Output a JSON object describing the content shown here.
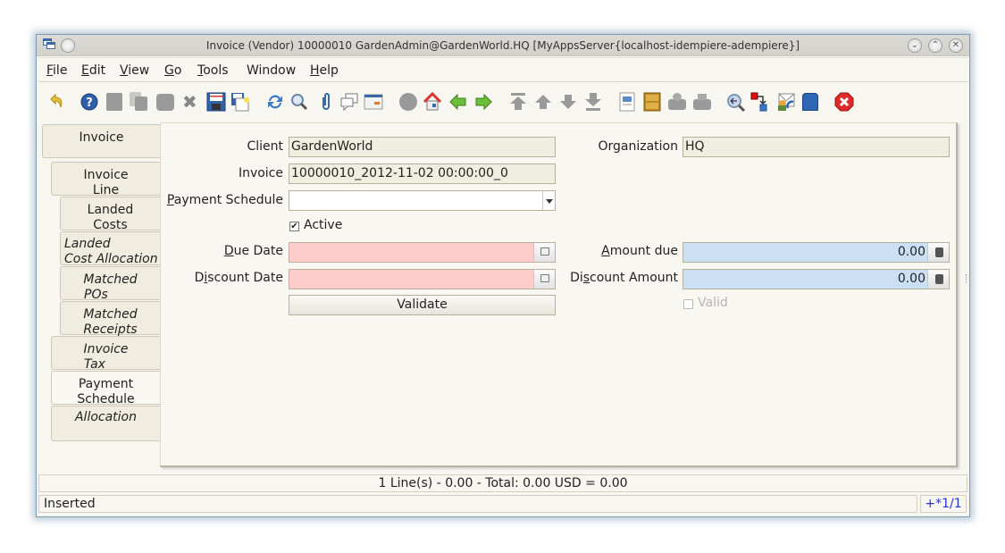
{
  "window": {
    "title": "Invoice (Vendor)  10000010  GardenAdmin@GardenWorld.HQ [MyAppsServer{localhost-idempiere-adempiere}]",
    "controls": [
      "minimize",
      "maximize",
      "close"
    ]
  },
  "menu": [
    {
      "label": "File",
      "mnemonic": "F"
    },
    {
      "label": "Edit",
      "mnemonic": "E"
    },
    {
      "label": "View",
      "mnemonic": "V"
    },
    {
      "label": "Go",
      "mnemonic": "G"
    },
    {
      "label": "Tools",
      "mnemonic": "T"
    },
    {
      "label": "Window",
      "mnemonic": ""
    },
    {
      "label": "Help",
      "mnemonic": "H"
    }
  ],
  "toolbar": [
    "undo-icon",
    "help-icon",
    "new-record-icon",
    "copy-record-icon",
    "delete-icon",
    "delete-selection-icon",
    "save-icon",
    "save-and-new-icon",
    "refresh-icon",
    "find-icon",
    "attachment-icon",
    "chat-icon",
    "grid-toggle-icon",
    "history-icon",
    "home-icon",
    "parent-record-icon",
    "detail-record-icon",
    "first-record-icon",
    "previous-record-icon",
    "next-record-icon",
    "last-record-icon",
    "report-icon",
    "archive-icon",
    "print-preview-icon",
    "print-icon",
    "zoom-across-icon",
    "active-workflows-icon",
    "request-icon",
    "product-info-icon",
    "exit-icon"
  ],
  "tabs": [
    {
      "label_line1": "Invoice",
      "label_line2": "",
      "italic": false,
      "selected": false
    },
    {
      "label_line1": "Invoice",
      "label_line2": "Line",
      "italic": false,
      "selected": false
    },
    {
      "label_line1": "Landed",
      "label_line2": "Costs",
      "italic": false,
      "selected": false
    },
    {
      "label_line1": "Landed",
      "label_line2": "Cost Allocation",
      "italic": true,
      "selected": false
    },
    {
      "label_line1": "Matched",
      "label_line2": "POs",
      "italic": true,
      "selected": false
    },
    {
      "label_line1": "Matched",
      "label_line2": "Receipts",
      "italic": true,
      "selected": false
    },
    {
      "label_line1": "Invoice",
      "label_line2": "Tax",
      "italic": true,
      "selected": false
    },
    {
      "label_line1": "Payment",
      "label_line2": "Schedule",
      "italic": false,
      "selected": true
    },
    {
      "label_line1": "Allocation",
      "label_line2": "",
      "italic": true,
      "selected": false
    }
  ],
  "form": {
    "client": {
      "label": "Client",
      "value": "GardenWorld"
    },
    "organization": {
      "label": "Organization",
      "value": "HQ"
    },
    "invoice": {
      "label": "Invoice",
      "value": "10000010_2012-11-02 00:00:00_0"
    },
    "payment_schedule": {
      "label": "Payment Schedule",
      "value": ""
    },
    "active": {
      "label": "Active",
      "checked": true
    },
    "due_date": {
      "label": "Due Date",
      "value": ""
    },
    "amount_due": {
      "label": "Amount due",
      "value": "0.00"
    },
    "discount_date": {
      "label": "Discount Date",
      "value": ""
    },
    "discount_amount": {
      "label": "Discount Amount",
      "value": "0.00"
    },
    "validate_button": "Validate",
    "valid": {
      "label": "Valid",
      "checked": false
    }
  },
  "status": {
    "summary": "1 Line(s) - 0.00 -  Total: 0.00  USD  =  0.00",
    "message": "Inserted",
    "record_info": "+*1/1"
  },
  "colors": {
    "mandatory_field": "#ffcccc",
    "readonly_field": "#f0eee0",
    "numeric_field": "#cce0f5",
    "record_info": "#2233cc"
  }
}
